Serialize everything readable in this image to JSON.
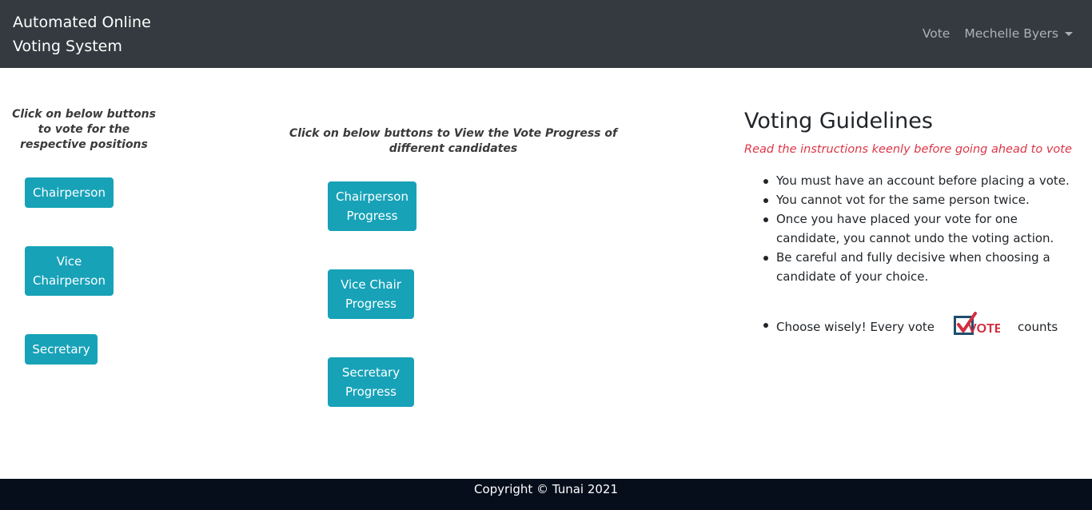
{
  "navbar": {
    "brand_line1": "Automated Online",
    "brand_line2": "Voting System",
    "vote_link": "Vote",
    "user_name": "Mechelle Byers"
  },
  "left_column": {
    "heading": "Click on below buttons to vote for the respective positions",
    "buttons": [
      {
        "label": "Chairperson"
      },
      {
        "label": "Vice Chairperson"
      },
      {
        "label": "Secretary"
      }
    ]
  },
  "middle_column": {
    "heading": "Click on below buttons to View the Vote Progress of different candidates",
    "buttons": [
      {
        "label": "Chairperson Progress"
      },
      {
        "label": "Vice Chair Progress"
      },
      {
        "label": "Secretary Progress"
      }
    ]
  },
  "guidelines": {
    "title": "Voting Guidelines",
    "subtitle": "Read the instructions keenly before going ahead to vote",
    "items": [
      "You must have an account before placing a vote.",
      "You cannot vot for the same person twice.",
      "Once you have placed your vote for one candidate, you cannot undo the voting action.",
      "Be careful and fully decisive when choosing a candidate of your choice."
    ],
    "choose_prefix": "Choose wisely! Every vote",
    "choose_logo_text": "VOTE",
    "choose_suffix": "counts"
  },
  "footer": {
    "copyright": "Copyright © Tunai 2021"
  },
  "colors": {
    "navbar_bg": "#343a40",
    "button_info": "#17a2b8",
    "subtitle_red": "#dc3545",
    "footer_bg": "#060e1c"
  }
}
